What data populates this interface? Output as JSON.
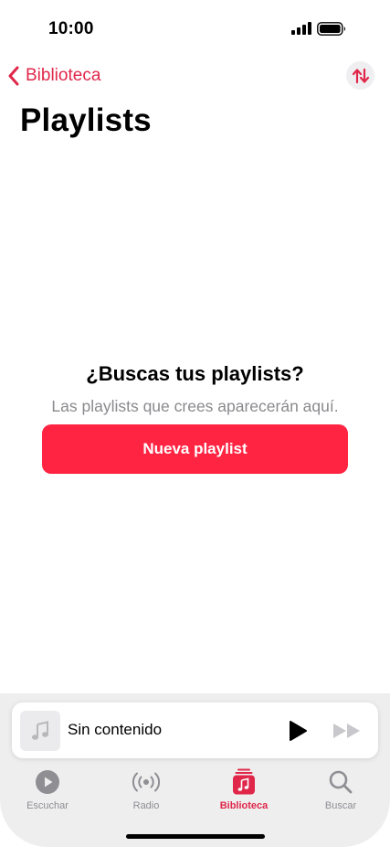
{
  "status_bar": {
    "time": "10:00"
  },
  "nav": {
    "back_label": "Biblioteca",
    "accent_color": "#e0274a"
  },
  "page": {
    "title": "Playlists"
  },
  "empty_state": {
    "title": "¿Buscas tus playlists?",
    "subtitle": "Las playlists que crees aparecerán aquí.",
    "button_label": "Nueva playlist",
    "button_color": "#ff2442"
  },
  "mini_player": {
    "track_title": "Sin contenido",
    "artwork_icon": "music-note-icon",
    "play_icon": "play-icon",
    "forward_icon": "forward-icon"
  },
  "tab_bar": {
    "tabs": [
      {
        "label": "Escuchar",
        "icon": "play-circle-icon",
        "active": false
      },
      {
        "label": "Radio",
        "icon": "radio-waves-icon",
        "active": false
      },
      {
        "label": "Biblioteca",
        "icon": "library-icon",
        "active": true
      },
      {
        "label": "Buscar",
        "icon": "search-icon",
        "active": false
      }
    ]
  }
}
